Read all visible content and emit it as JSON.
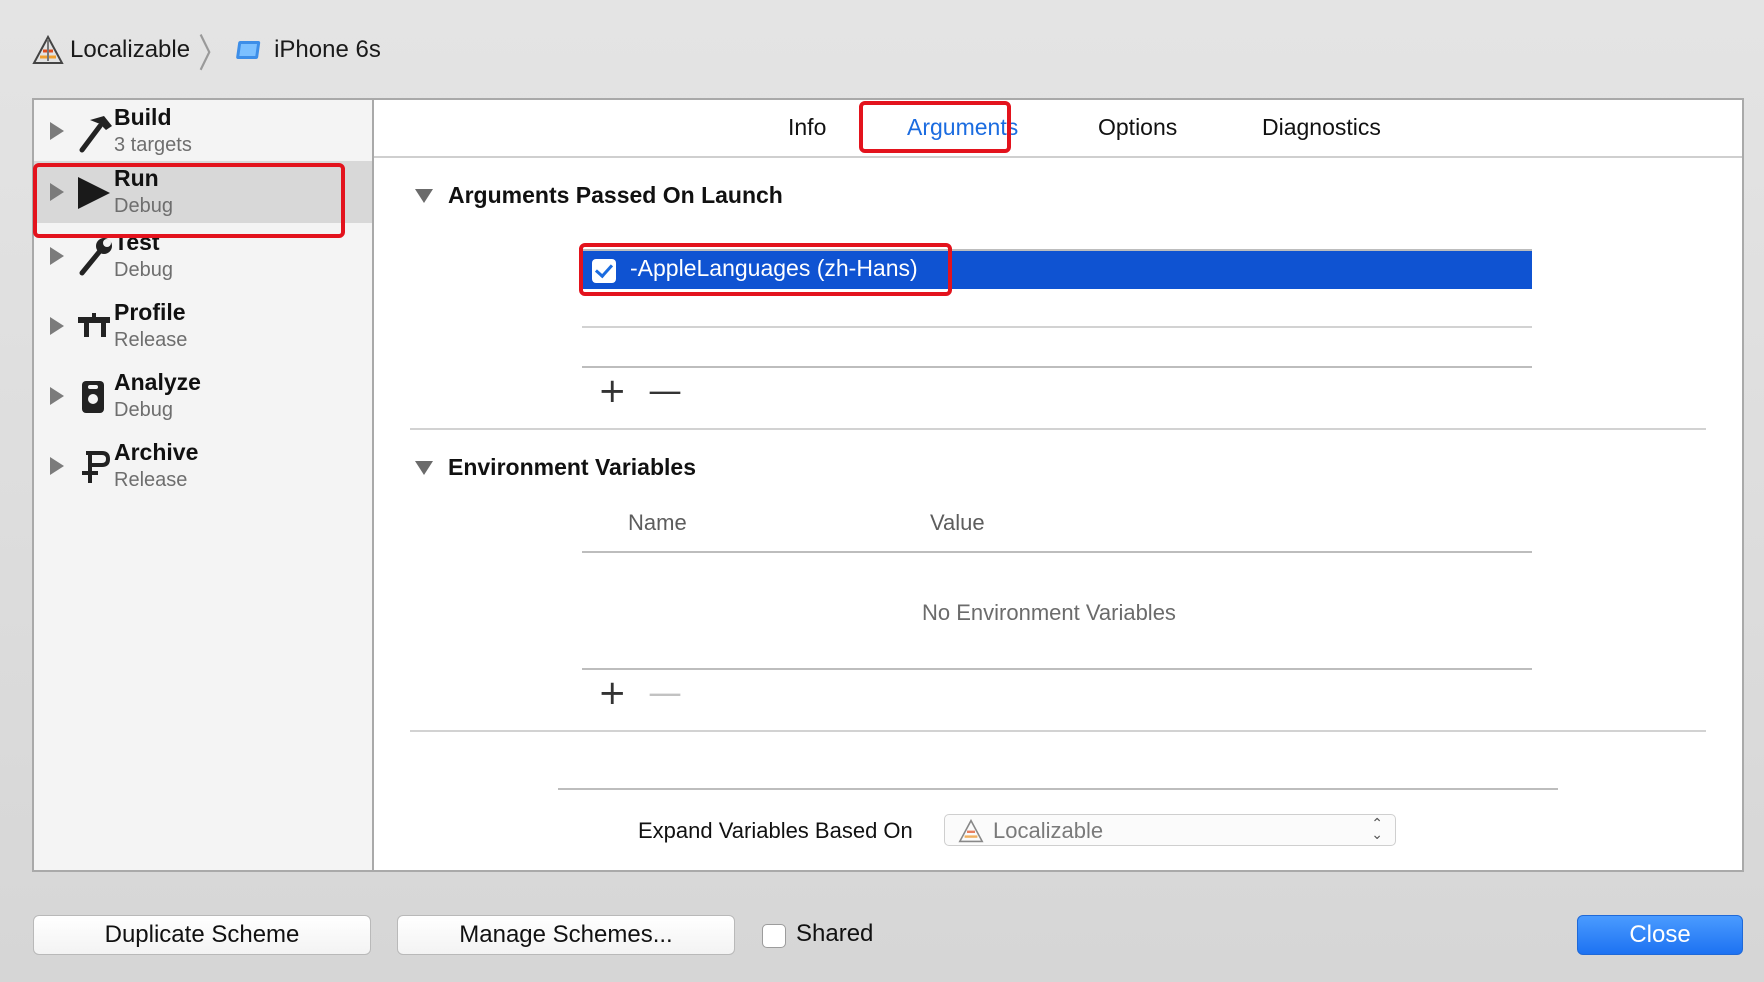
{
  "breadcrumb": {
    "project": "Localizable",
    "device": "iPhone 6s"
  },
  "sidebar": {
    "items": [
      {
        "title": "Build",
        "subtitle": "3 targets",
        "icon": "hammer-icon"
      },
      {
        "title": "Run",
        "subtitle": "Debug",
        "icon": "play-icon",
        "selected": true
      },
      {
        "title": "Test",
        "subtitle": "Debug",
        "icon": "wrench-icon"
      },
      {
        "title": "Profile",
        "subtitle": "Release",
        "icon": "instruments-icon"
      },
      {
        "title": "Analyze",
        "subtitle": "Debug",
        "icon": "analyze-icon"
      },
      {
        "title": "Archive",
        "subtitle": "Release",
        "icon": "archive-icon"
      }
    ]
  },
  "tabs": [
    {
      "label": "Info"
    },
    {
      "label": "Arguments",
      "active": true
    },
    {
      "label": "Options"
    },
    {
      "label": "Diagnostics"
    }
  ],
  "arguments": {
    "title": "Arguments Passed On Launch",
    "items": [
      {
        "text": "-AppleLanguages (zh-Hans)",
        "checked": true
      }
    ],
    "add_symbol": "+",
    "remove_symbol": "—"
  },
  "environment": {
    "title": "Environment Variables",
    "columns": [
      "Name",
      "Value"
    ],
    "empty_message": "No Environment Variables",
    "add_symbol": "+",
    "remove_symbol": "—"
  },
  "expand": {
    "label": "Expand Variables Based On",
    "selected": "Localizable"
  },
  "footer": {
    "duplicate_label": "Duplicate Scheme",
    "manage_label": "Manage Schemes...",
    "shared_label": "Shared",
    "shared_checked": false,
    "close_label": "Close"
  },
  "colors": {
    "accent": "#1b6ce0",
    "selection": "#0f53d2",
    "highlight_box": "#e3131d"
  }
}
